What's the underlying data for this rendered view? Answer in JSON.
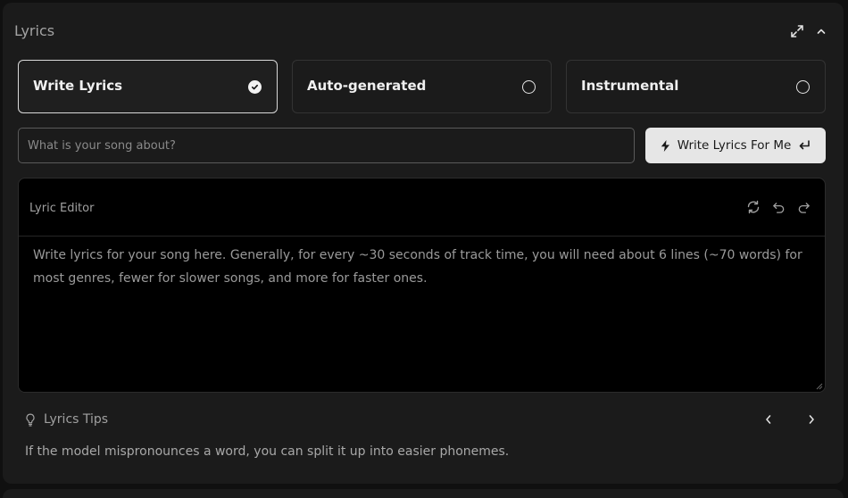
{
  "panel": {
    "title": "Lyrics",
    "expand_icon": "expand-arrows-icon",
    "collapse_icon": "chevron-up-icon"
  },
  "options": [
    {
      "label": "Write Lyrics",
      "selected": true
    },
    {
      "label": "Auto-generated",
      "selected": false
    },
    {
      "label": "Instrumental",
      "selected": false
    }
  ],
  "prompt": {
    "placeholder": "What is your song about?",
    "value": ""
  },
  "write_button": {
    "label": "Write Lyrics For Me",
    "icon": "lightning-icon",
    "trailing_icon": "enter-return-icon"
  },
  "editor": {
    "title": "Lyric Editor",
    "icons": [
      "refresh-icon",
      "undo-icon",
      "redo-icon"
    ],
    "placeholder": "Write lyrics for your song here. Generally, for every ~30 seconds of track time, you will need about 6 lines (~70 words) for most genres, fewer for slower songs, and more for faster ones.",
    "value": ""
  },
  "tips": {
    "label": "Lyrics Tips",
    "icon": "lightbulb-icon",
    "text": "If the model mispronounces a word, you can split it up into easier phonemes."
  },
  "colors": {
    "background": "#1b1b1b",
    "editor_background": "#000000",
    "accent_button": "#e6e6e6",
    "selected_border": "#d9d9d9"
  }
}
